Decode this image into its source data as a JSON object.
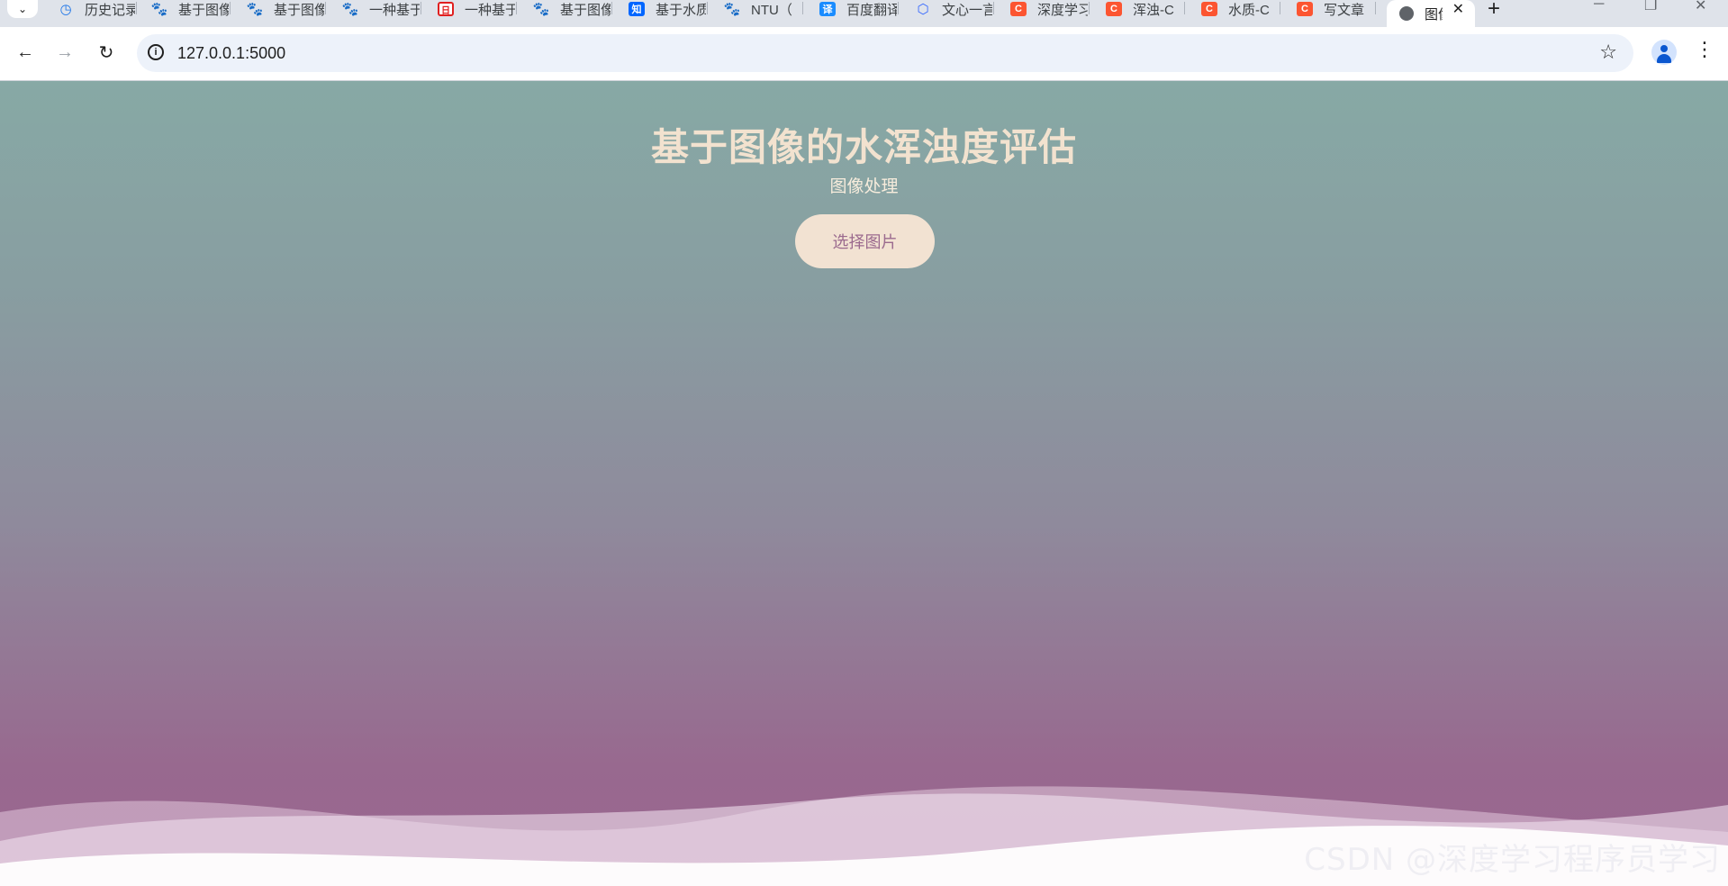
{
  "browser": {
    "tabs": [
      {
        "label": "历史记录",
        "favicon": "clock-icon"
      },
      {
        "label": "基于图像",
        "favicon": "baidu-paw-icon"
      },
      {
        "label": "基于图像",
        "favicon": "baidu-paw-icon"
      },
      {
        "label": "一种基于",
        "favicon": "baidu-paw-icon"
      },
      {
        "label": "一种基于",
        "favicon": "red-logo-icon"
      },
      {
        "label": "基于图像",
        "favicon": "baidu-paw-icon"
      },
      {
        "label": "基于水质",
        "favicon": "zhihu-icon"
      },
      {
        "label": "NTU（",
        "favicon": "baidu-paw-icon"
      },
      {
        "label": "百度翻译",
        "favicon": "translate-icon"
      },
      {
        "label": "文心一言",
        "favicon": "wenxin-icon"
      },
      {
        "label": "深度学习",
        "favicon": "csdn-icon"
      },
      {
        "label": "浑浊-C",
        "favicon": "csdn-icon"
      },
      {
        "label": "水质-C",
        "favicon": "csdn-icon"
      },
      {
        "label": "写文章",
        "favicon": "csdn-icon"
      }
    ],
    "active_tab": {
      "label": "图像",
      "favicon": "globe-icon"
    },
    "url": "127.0.0.1:5000"
  },
  "page": {
    "title": "基于图像的水浑浊度评估",
    "subtitle": "图像处理",
    "select_button": "选择图片",
    "watermark": "CSDN @深度学习程序员学习"
  },
  "colors": {
    "gradient_top": "#87a9a5",
    "gradient_bottom": "#9b6590",
    "title_color": "#f2e2cf",
    "button_bg": "#f2e2d2",
    "button_text": "#9b6a8e"
  }
}
